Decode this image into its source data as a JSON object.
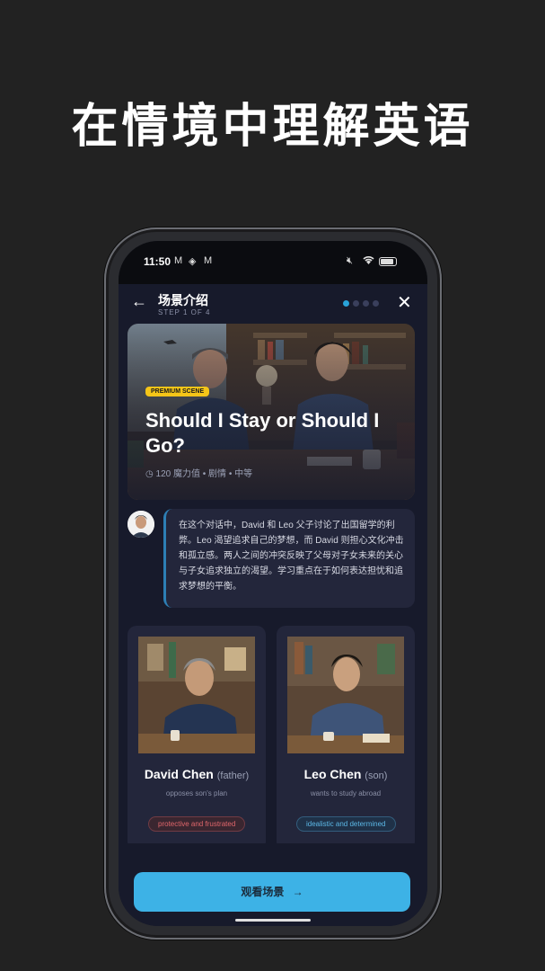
{
  "headline": "在情境中理解英语",
  "status": {
    "time": "11:50",
    "icons": [
      "gmail-icon",
      "layers-icon",
      "gmail-icon",
      "mute-icon",
      "wifi-icon",
      "battery-icon"
    ],
    "battery_level": 0.85
  },
  "nav": {
    "title": "场景介绍",
    "step": "STEP 1 OF 4",
    "current_step": 1,
    "total_steps": 4
  },
  "scene": {
    "badge": "PREMIUM SCENE",
    "title": "Should I Stay or Should I Go?",
    "meta": "120 魔力值 • 剧情 • 中等"
  },
  "description": "在这个对话中，David 和 Leo 父子讨论了出国留学的利弊。Leo 渴望追求自己的梦想，而 David 则担心文化冲击和孤立感。两人之间的冲突反映了父母对子女未来的关心与子女追求独立的渴望。学习重点在于如何表达担忧和追求梦想的平衡。",
  "characters": [
    {
      "name": "David Chen",
      "role": "(father)",
      "subtitle": "opposes son's plan",
      "tag": "protective and frustrated",
      "tag_color": "#e0666b",
      "tag_bg": "#3a2630"
    },
    {
      "name": "Leo Chen",
      "role": "(son)",
      "subtitle": "wants to study abroad",
      "tag": "idealistic and determined",
      "tag_color": "#5cb8e6",
      "tag_bg": "#1f3148"
    }
  ],
  "cta": {
    "label": "观看场景",
    "arrow": "→"
  }
}
